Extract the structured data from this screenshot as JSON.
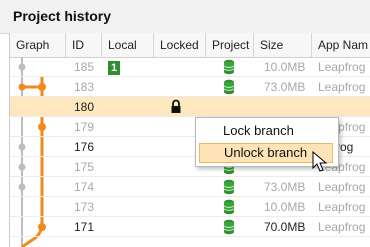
{
  "panel": {
    "title": "Project history"
  },
  "columns": [
    "Graph",
    "ID",
    "Local",
    "Locked",
    "Project",
    "Size",
    "App Nam"
  ],
  "rows": [
    {
      "id": "185",
      "local": "1",
      "locked": false,
      "project": "database-icon",
      "size": "10.0MB",
      "app": "Leapfrog",
      "dim": true
    },
    {
      "id": "183",
      "local": "",
      "locked": false,
      "project": "database-icon",
      "size": "73.0MB",
      "app": "Leapfrog",
      "dim": true
    },
    {
      "id": "180",
      "local": "",
      "locked": true,
      "project": "",
      "size": "",
      "app": "",
      "dim": false,
      "selected": true
    },
    {
      "id": "179",
      "local": "",
      "locked": false,
      "project": "",
      "size": "",
      "app": "Leapfrog",
      "dim": true
    },
    {
      "id": "176",
      "local": "",
      "locked": false,
      "project": "",
      "size": "",
      "app": "pfrog",
      "dim": false
    },
    {
      "id": "175",
      "local": "",
      "locked": false,
      "project": "database-icon",
      "size": "",
      "app": "Leapfrog",
      "dim": true
    },
    {
      "id": "174",
      "local": "",
      "locked": false,
      "project": "database-icon",
      "size": "73.0MB",
      "app": "Leapfrog",
      "dim": true
    },
    {
      "id": "173",
      "local": "",
      "locked": false,
      "project": "database-icon",
      "size": "10.0MB",
      "app": "Leapfrog",
      "dim": true
    },
    {
      "id": "171",
      "local": "",
      "locked": false,
      "project": "database-icon",
      "size": "70.0MB",
      "app": "Leapfrog",
      "dim": false
    }
  ],
  "context_menu": {
    "items": [
      {
        "label": "Lock branch",
        "hover": false
      },
      {
        "label": "Unlock branch",
        "hover": true
      }
    ]
  },
  "colors": {
    "branch": "#f28a1b",
    "trunk": "#bdbdbd",
    "selected_row": "#fde7bf",
    "local_badge": "#2f8f2f",
    "db_icon": "#2f8f2f"
  },
  "icons": {
    "locked": "lock-icon",
    "project": "database-icon",
    "cursor": "arrow-cursor-icon"
  }
}
